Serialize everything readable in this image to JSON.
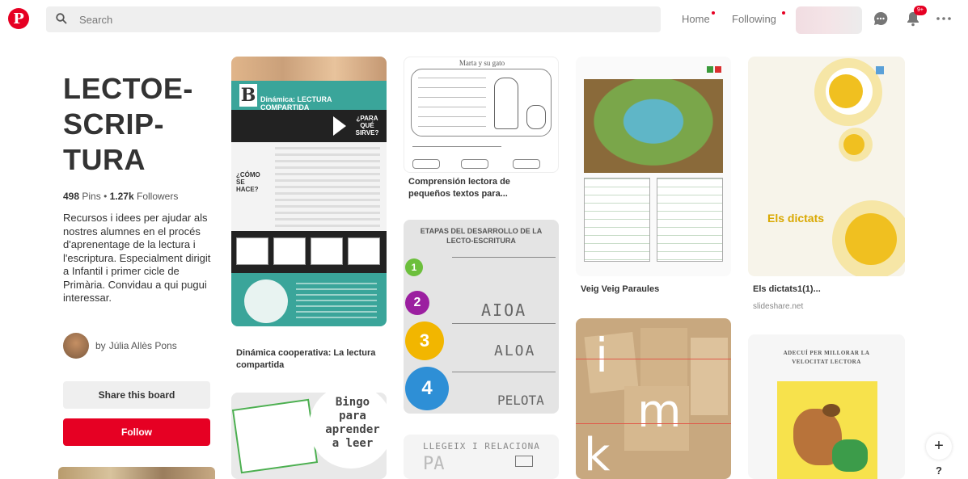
{
  "header": {
    "logo": "P",
    "search_placeholder": "Search",
    "nav_home": "Home",
    "nav_following": "Following",
    "notif_badge": "9+"
  },
  "board": {
    "title_lines": [
      "LECTOE-",
      "SCRIP-",
      "TURA"
    ],
    "pins_count": "498",
    "pins_label": "Pins",
    "followers_count": "1.27k",
    "followers_label": "Followers",
    "description": "Recursos i idees per ajudar als nostres alumnes en el procés d'aprenentage de la lectura i l'escriptura. Especialment dirigit a Infantil i primer cicle de Primària. Convidau a qui pugui interessar.",
    "author_prefix": "by",
    "author_name": "Júlia Allès Pons",
    "share_label": "Share this board",
    "follow_label": "Follow"
  },
  "pins": [
    {
      "caption": "Dinámica cooperativa: La lectura compartida",
      "img_title": "Dinámica: LECTURA COMPARTIDA",
      "img_side": "¿PARA QUÉ SIRVE?",
      "img_how": "¿CÓMO SE HACE?"
    },
    {
      "caption": "",
      "img_title": "Bingo para aprender a leer"
    },
    {
      "caption": "Comprensión lectora de pequeños textos para...",
      "img_title": "Marta y su gato"
    },
    {
      "caption": "",
      "img_title": "ETAPAS DEL DESARROLLO DE LA LECTO-ESCRITURA",
      "steps": [
        "1",
        "2",
        "3",
        "4"
      ],
      "words": [
        "AIOA",
        "ALOA",
        "PELOTA"
      ]
    },
    {
      "caption": "",
      "img_title": "LLEGEIX I RELACIONA",
      "img_word": "PA"
    },
    {
      "caption": "Veig Veig Paraules"
    },
    {
      "caption": "",
      "letters": [
        "i",
        "m",
        "k"
      ]
    },
    {
      "caption": "Els dictats1(1)...",
      "source": "slideshare.net",
      "img_title": "Els dictats"
    },
    {
      "caption": "",
      "img_title": "ADECUÍ PER MILLORAR LA VELOCITAT LECTORA"
    }
  ],
  "colors": {
    "brand": "#e60023",
    "teal": "#3aa59a"
  },
  "float_buttons": {
    "add": "+",
    "help": "?"
  }
}
